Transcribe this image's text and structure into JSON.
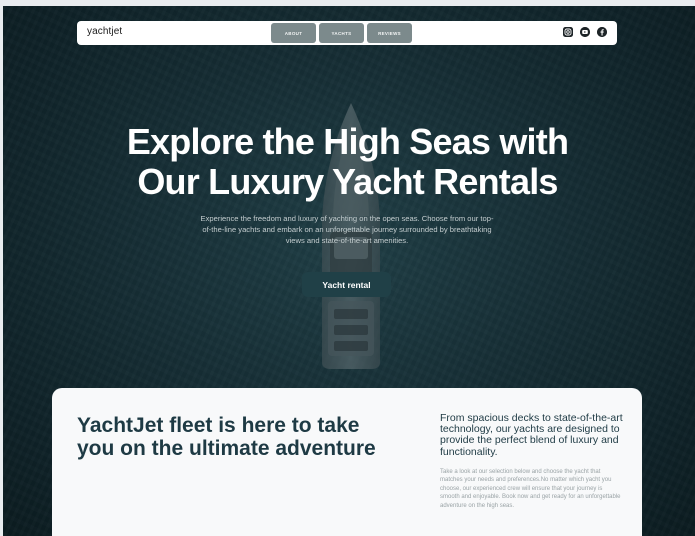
{
  "navbar": {
    "brand": "yachtjet",
    "links": [
      "ABOUT",
      "YACHTS",
      "REVIEWS"
    ],
    "socials": [
      "instagram-icon",
      "youtube-icon",
      "facebook-icon"
    ]
  },
  "hero": {
    "title_line1": "Explore the High Seas with",
    "title_line2": "Our Luxury Yacht Rentals",
    "subtitle": "Experience the freedom and luxury of yachting on the open seas. Choose from our top-of-the-line yachts and embark on an unforgettable journey surrounded by breathtaking views and state-of-the-art amenities.",
    "cta_label": "Yacht rental"
  },
  "fleet": {
    "heading": "YachtJet fleet is here to take you on the ultimate adventure",
    "lead": "From spacious decks to state-of-the-art technology, our yachts are designed to provide the perfect blend of luxury and functionality.",
    "body": "Take a look at our selection below and choose the yacht that matches your needs and preferences.No matter which yacht you choose, our experienced crew will ensure that your journey is smooth and enjoyable. Book now and get ready for an unforgettable adventure on the high seas."
  },
  "colors": {
    "sea": "#162f36",
    "nav_button": "#7c8a8c",
    "cta": "#204047",
    "heading_text": "#1e3a44",
    "card_bg": "#f8f9fa"
  }
}
